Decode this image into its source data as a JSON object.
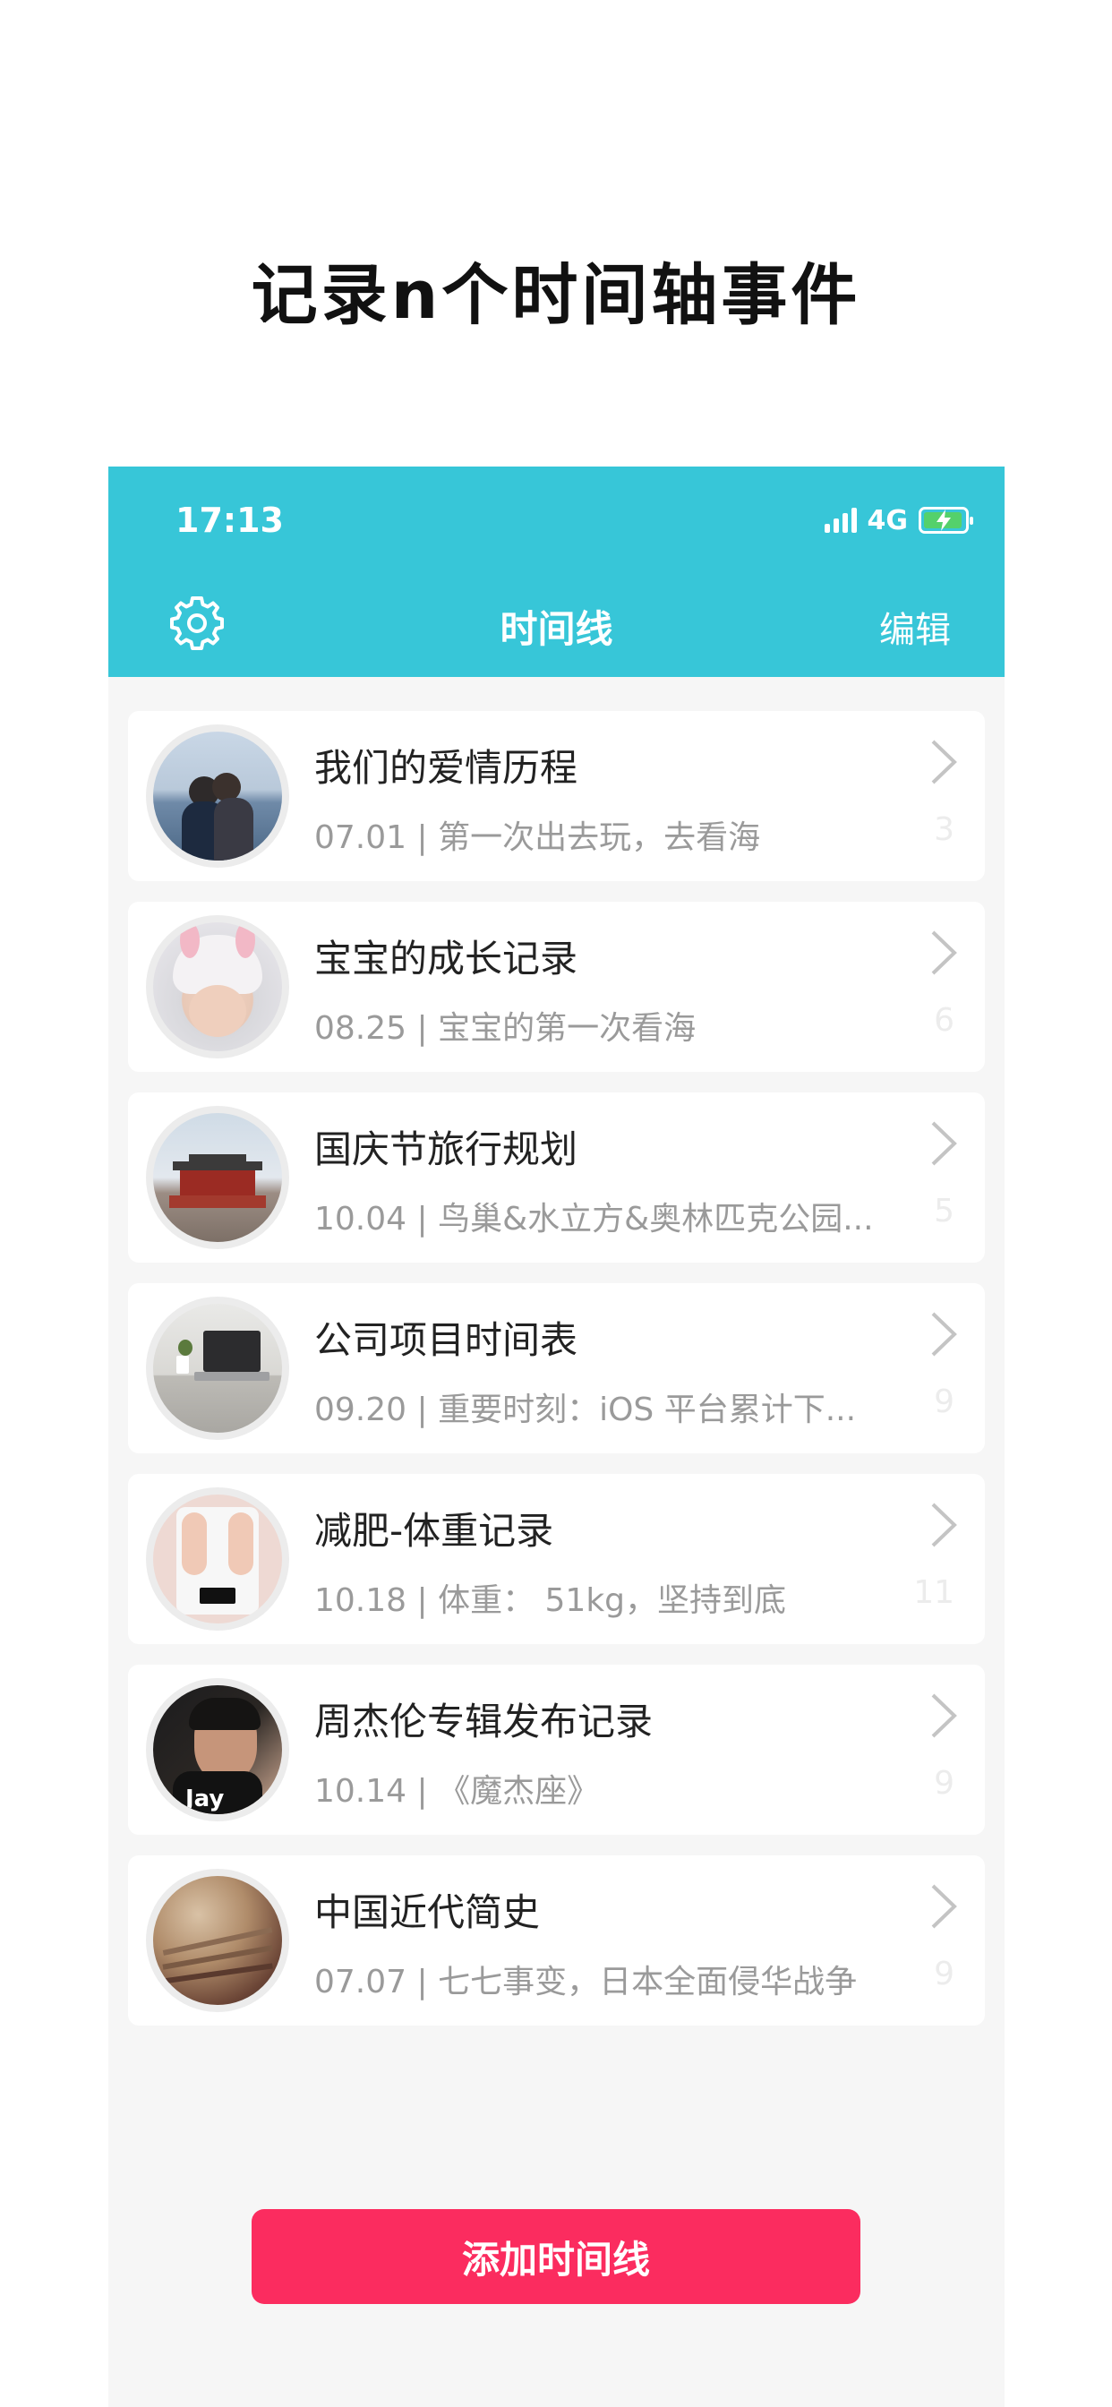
{
  "promo": {
    "title": "记录n个时间轴事件"
  },
  "status_bar": {
    "time": "17:13",
    "network": "4G",
    "icons": [
      "signal-icon",
      "battery-charging-icon"
    ]
  },
  "nav": {
    "title": "时间线",
    "edit_label": "编辑",
    "settings_icon": "gear-icon"
  },
  "colors": {
    "nav": "#37c6d8",
    "accent": "#fb2c5f",
    "background": "#f6f6f6"
  },
  "timelines": [
    {
      "title": "我们的爱情历程",
      "subtitle": "07.01 | 第一次出去玩，去看海",
      "count": "3",
      "thumb": "couple-at-sea"
    },
    {
      "title": "宝宝的成长记录",
      "subtitle": "08.25 | 宝宝的第一次看海",
      "count": "6",
      "thumb": "baby-in-bunny-hat"
    },
    {
      "title": "国庆节旅行规划",
      "subtitle": "10.04 | 鸟巢&水立方&奥林匹克公园...",
      "count": "5",
      "thumb": "tiananmen-gate"
    },
    {
      "title": "公司项目时间表",
      "subtitle": "09.20 | 重要时刻：iOS 平台累计下...",
      "count": "9",
      "thumb": "laptop-desk"
    },
    {
      "title": "减肥-体重记录",
      "subtitle": "10.18 | 体重： 51kg，坚持到底",
      "count": "11",
      "thumb": "feet-on-scale"
    },
    {
      "title": "周杰伦专辑发布记录",
      "subtitle": "10.14 | 《魔杰座》",
      "count": "9",
      "thumb": "album-cover"
    },
    {
      "title": "中国近代简史",
      "subtitle": "07.07 | 七七事变，日本全面侵华战争",
      "count": "9",
      "thumb": "old-book"
    }
  ],
  "add_button": {
    "label": "添加时间线"
  }
}
